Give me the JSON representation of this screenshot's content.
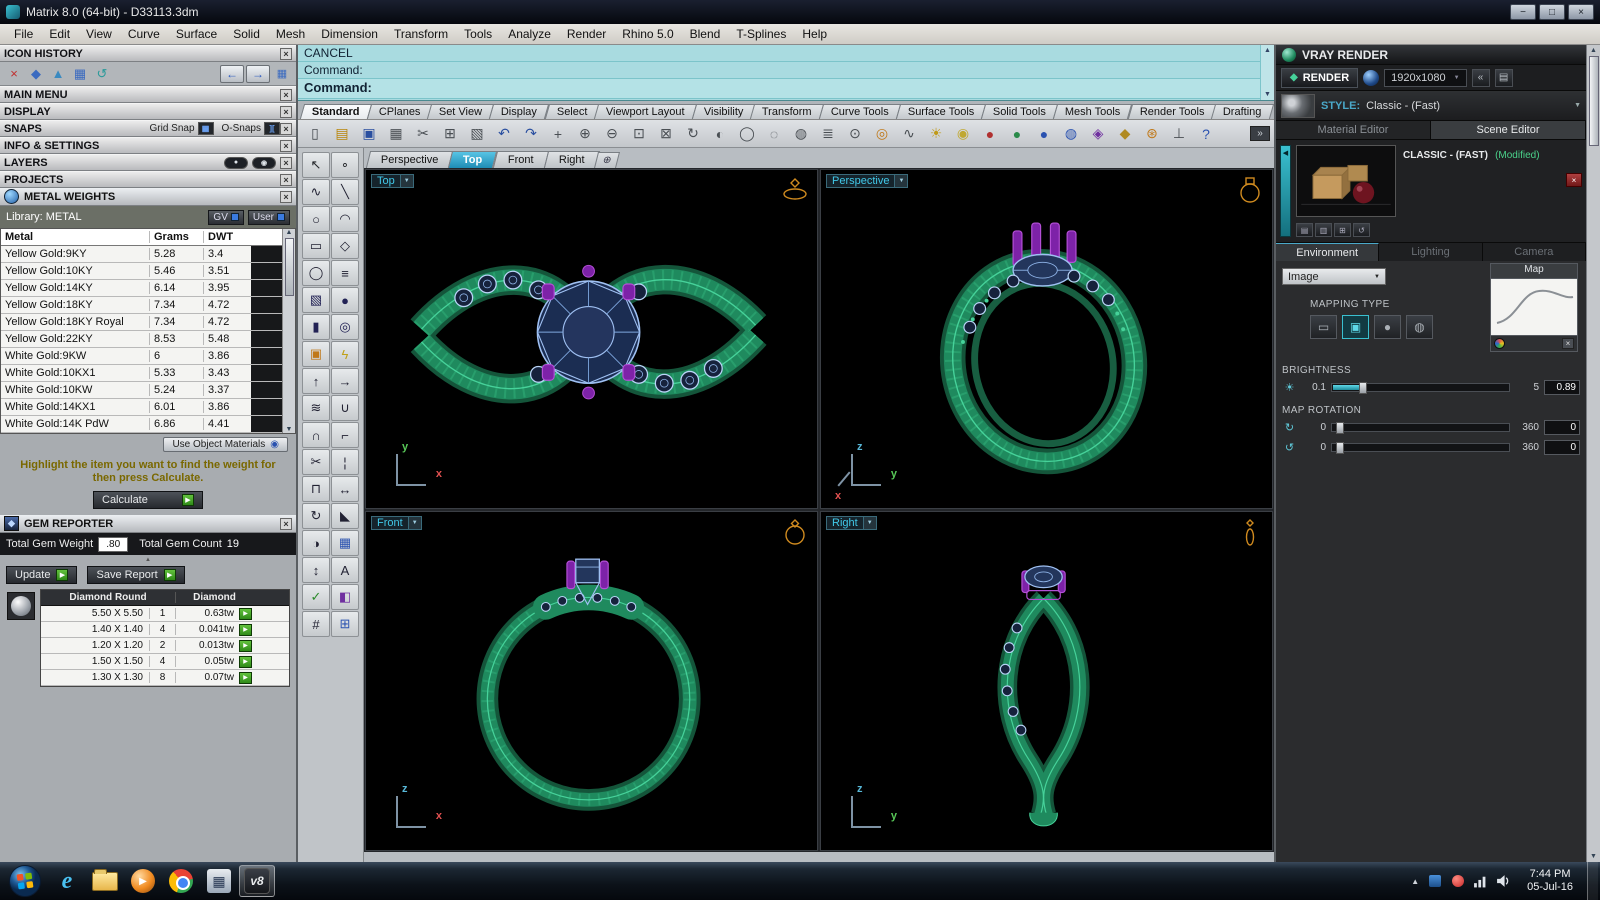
{
  "window": {
    "title": "Matrix 8.0 (64-bit) - D33113.3dm"
  },
  "glyphs": {
    "dropdown": "▼",
    "close": "×",
    "up": "▲",
    "down": "▼",
    "play": "▶",
    "back": "←",
    "forward": "→",
    "overflow": "»",
    "plus": "⊕",
    "grid": "▦",
    "minimize": "−",
    "maximize": "□",
    "collapse": "▲",
    "left_collapse": "◀",
    "sun": "☀",
    "rotate_u": "↻",
    "rotate_v": "↺",
    "ie": "e",
    "wmp_play": "▶",
    "calc_grid": "▦",
    "v8": "v8",
    "double_back": "«",
    "frames": "▤"
  },
  "menu": {
    "items": [
      "File",
      "Edit",
      "View",
      "Curve",
      "Surface",
      "Solid",
      "Mesh",
      "Dimension",
      "Transform",
      "Tools",
      "Analyze",
      "Render",
      "Rhino 5.0",
      "Blend",
      "T-Splines",
      "Help"
    ]
  },
  "command": {
    "line1": "CANCEL",
    "line2": "Command:",
    "prompt": "Command:"
  },
  "toolbar_tabs": [
    "Standard",
    "CPlanes",
    "Set View",
    "Display",
    "Select",
    "Viewport Layout",
    "Visibility",
    "Transform",
    "Curve Tools",
    "Surface Tools",
    "Solid Tools",
    "Mesh Tools",
    "Render Tools",
    "Drafting"
  ],
  "main_toolbar": {
    "icons": [
      {
        "name": "new-file-icon",
        "glyph": "▯",
        "color": "#4a4f54"
      },
      {
        "name": "open-file-icon",
        "glyph": "▤",
        "color": "#b8860b"
      },
      {
        "name": "save-icon",
        "glyph": "▣",
        "color": "#2a4fa0"
      },
      {
        "name": "print-icon",
        "glyph": "▦",
        "color": "#4a4f54"
      },
      {
        "name": "cut-icon",
        "glyph": "✂",
        "color": "#4a4f54"
      },
      {
        "name": "copy-icon",
        "glyph": "⊞",
        "color": "#4a4f54"
      },
      {
        "name": "paste-icon",
        "glyph": "▧",
        "color": "#4a4f54"
      },
      {
        "name": "undo-icon",
        "glyph": "↶",
        "color": "#2a4fa0"
      },
      {
        "name": "redo-icon",
        "glyph": "↷",
        "color": "#2a4fa0"
      },
      {
        "name": "pan-icon",
        "glyph": "+",
        "color": "#4a4f54"
      },
      {
        "name": "zoom-in-icon",
        "glyph": "⊕",
        "color": "#4a4f54"
      },
      {
        "name": "zoom-out-icon",
        "glyph": "⊖",
        "color": "#4a4f54"
      },
      {
        "name": "zoom-window-icon",
        "glyph": "⊡",
        "color": "#4a4f54"
      },
      {
        "name": "zoom-extents-icon",
        "glyph": "⊠",
        "color": "#4a4f54"
      },
      {
        "name": "rotate-view-icon",
        "glyph": "↻",
        "color": "#4a4f54"
      },
      {
        "name": "shaded-view-icon",
        "glyph": "◐",
        "color": "#4a4f54"
      },
      {
        "name": "wireframe-view-icon",
        "glyph": "◯",
        "color": "#4a4f54"
      },
      {
        "name": "hide-objects-icon",
        "glyph": "◌",
        "color": "#4a4f54"
      },
      {
        "name": "lock-objects-icon",
        "glyph": "◍",
        "color": "#4a4f54"
      },
      {
        "name": "layer-manager-icon",
        "glyph": "≣",
        "color": "#4a4f54"
      },
      {
        "name": "object-snap-icon",
        "glyph": "⊙",
        "color": "#4a4f54"
      },
      {
        "name": "gumball-icon",
        "glyph": "◎",
        "color": "#c07818"
      },
      {
        "name": "record-history-icon",
        "glyph": "∿",
        "color": "#4a4f54"
      },
      {
        "name": "sun-light-icon",
        "glyph": "☀",
        "color": "#c09a18"
      },
      {
        "name": "bulb-icon",
        "glyph": "◉",
        "color": "#c0a830"
      },
      {
        "name": "material-red-icon",
        "glyph": "●",
        "color": "#b03030"
      },
      {
        "name": "material-green-icon",
        "glyph": "●",
        "color": "#2a8a4a"
      },
      {
        "name": "material-blue-icon",
        "glyph": "●",
        "color": "#2a52b0"
      },
      {
        "name": "environment-icon",
        "glyph": "◍",
        "color": "#2a52b0"
      },
      {
        "name": "texture-icon",
        "glyph": "◈",
        "color": "#7030a0"
      },
      {
        "name": "gem-drop-icon",
        "glyph": "◆",
        "color": "#b08a20"
      },
      {
        "name": "settings-gear-icon",
        "glyph": "⊛",
        "color": "#c07818"
      },
      {
        "name": "cplane-icon",
        "glyph": "⊥",
        "color": "#4a4f54"
      },
      {
        "name": "help-icon",
        "glyph": "?",
        "color": "#2a52b0"
      }
    ]
  },
  "tool_palette": {
    "icons": [
      {
        "name": "select-pointer-icon",
        "glyph": "↖",
        "color": "#23262a"
      },
      {
        "name": "point-tool-icon",
        "glyph": "∘",
        "color": "#23262a"
      },
      {
        "name": "curve-tool-icon",
        "glyph": "∿",
        "color": "#223"
      },
      {
        "name": "line-tool-icon",
        "glyph": "╲",
        "color": "#223"
      },
      {
        "name": "circle-tool-icon",
        "glyph": "○",
        "color": "#223"
      },
      {
        "name": "arc-tool-icon",
        "glyph": "◠",
        "color": "#223"
      },
      {
        "name": "rectangle-tool-icon",
        "glyph": "▭",
        "color": "#223"
      },
      {
        "name": "polygon-tool-icon",
        "glyph": "◇",
        "color": "#223"
      },
      {
        "name": "ellipse-tool-icon",
        "glyph": "◯",
        "color": "#223"
      },
      {
        "name": "offset-tool-icon",
        "glyph": "≡",
        "color": "#223"
      },
      {
        "name": "box-tool-icon",
        "glyph": "▧",
        "color": "#225"
      },
      {
        "name": "sphere-tool-icon",
        "glyph": "●",
        "color": "#225"
      },
      {
        "name": "cylinder-tool-icon",
        "glyph": "▮",
        "color": "#225"
      },
      {
        "name": "torus-tool-icon",
        "glyph": "◎",
        "color": "#225"
      },
      {
        "name": "puzzle-builder-icon",
        "glyph": "▣",
        "color": "#c07818"
      },
      {
        "name": "lightning-fast-icon",
        "glyph": "ϟ",
        "color": "#c0a018"
      },
      {
        "name": "extrude-tool-icon",
        "glyph": "↑",
        "color": "#223"
      },
      {
        "name": "sweep-tool-icon",
        "glyph": "→",
        "color": "#223"
      },
      {
        "name": "loft-tool-icon",
        "glyph": "≋",
        "color": "#223"
      },
      {
        "name": "boolean-union-icon",
        "glyph": "∪",
        "color": "#223"
      },
      {
        "name": "boolean-diff-icon",
        "glyph": "∩",
        "color": "#223"
      },
      {
        "name": "fillet-tool-icon",
        "glyph": "⌐",
        "color": "#223"
      },
      {
        "name": "trim-tool-icon",
        "glyph": "✂",
        "color": "#223"
      },
      {
        "name": "split-tool-icon",
        "glyph": "¦",
        "color": "#223"
      },
      {
        "name": "join-tool-icon",
        "glyph": "⊓",
        "color": "#223"
      },
      {
        "name": "move-tool-icon",
        "glyph": "↔",
        "color": "#223"
      },
      {
        "name": "rotate-tool-icon",
        "glyph": "↻",
        "color": "#223"
      },
      {
        "name": "scale-tool-icon",
        "glyph": "◣",
        "color": "#223"
      },
      {
        "name": "mirror-tool-icon",
        "glyph": "◑",
        "color": "#223"
      },
      {
        "name": "array-tool-icon",
        "glyph": "▦",
        "color": "#2a52b0"
      },
      {
        "name": "dimension-tool-icon",
        "glyph": "↕",
        "color": "#223"
      },
      {
        "name": "text-tool-icon",
        "glyph": "A",
        "color": "#223"
      },
      {
        "name": "check-tool-icon",
        "glyph": "✓",
        "color": "#2a8a2a"
      },
      {
        "name": "paint-tool-icon",
        "glyph": "◧",
        "color": "#7030a0"
      },
      {
        "name": "measure-tool-icon",
        "glyph": "#",
        "color": "#223"
      },
      {
        "name": "grid-display-icon",
        "glyph": "⊞",
        "color": "#2a52b0"
      }
    ]
  },
  "viewport_tabs": [
    "Perspective",
    "Top",
    "Front",
    "Right"
  ],
  "viewports": [
    {
      "label": "Top",
      "up_axis": "y",
      "right_axis": "x"
    },
    {
      "label": "Perspective",
      "up_axis": "z",
      "right_axis": "y",
      "depth_axis": "x"
    },
    {
      "label": "Front",
      "up_axis": "z",
      "right_axis": "x"
    },
    {
      "label": "Right",
      "up_axis": "z",
      "right_axis": "y"
    }
  ],
  "sidebar": {
    "icon_history_title": "ICON HISTORY",
    "history_icons": [
      {
        "name": "history-delete-icon",
        "glyph": "×",
        "color": "#c03030"
      },
      {
        "name": "history-gem-icon",
        "glyph": "◆",
        "color": "#3a6ac0"
      },
      {
        "name": "history-prong-icon",
        "glyph": "▲",
        "color": "#3a8ac0"
      },
      {
        "name": "history-pave-icon",
        "glyph": "▦",
        "color": "#3a6ac0"
      },
      {
        "name": "history-rail-icon",
        "glyph": "↺",
        "color": "#2a9a9a"
      }
    ],
    "main_menu_title": "MAIN MENU",
    "display_title": "DISPLAY",
    "snaps_title": "SNAPS",
    "grid_snap_label": "Grid Snap",
    "o_snaps_label": "O-Snaps",
    "info_settings_title": "INFO & SETTINGS",
    "layers_title": "LAYERS",
    "projects_title": "PROJECTS"
  },
  "metal_weights": {
    "title": "METAL WEIGHTS",
    "library_label": "Library: METAL",
    "gv_label": "GV",
    "user_label": "User",
    "columns": [
      "Metal",
      "Grams",
      "DWT"
    ],
    "rows": [
      [
        "Yellow Gold:9KY",
        "5.28",
        "3.4"
      ],
      [
        "Yellow Gold:10KY",
        "5.46",
        "3.51"
      ],
      [
        "Yellow Gold:14KY",
        "6.14",
        "3.95"
      ],
      [
        "Yellow Gold:18KY",
        "7.34",
        "4.72"
      ],
      [
        "Yellow Gold:18KY Royal",
        "7.34",
        "4.72"
      ],
      [
        "Yellow Gold:22KY",
        "8.53",
        "5.48"
      ],
      [
        "White Gold:9KW",
        "6",
        "3.86"
      ],
      [
        "White Gold:10KX1",
        "5.33",
        "3.43"
      ],
      [
        "White Gold:10KW",
        "5.24",
        "3.37"
      ],
      [
        "White Gold:14KX1",
        "6.01",
        "3.86"
      ],
      [
        "White Gold:14K PdW",
        "6.86",
        "4.41"
      ]
    ],
    "use_object_materials": "Use Object Materials",
    "hint": "Highlight the item you want to find the weight for then press Calculate.",
    "calculate_label": "Calculate"
  },
  "gem_reporter": {
    "title": "GEM REPORTER",
    "total_weight_label": "Total Gem Weight",
    "total_weight": ".80",
    "total_count_label": "Total Gem Count",
    "total_count": "19",
    "update_label": "Update",
    "save_report_label": "Save Report",
    "columns": [
      "Diamond Round",
      "Diamond"
    ],
    "rows": [
      [
        "5.50 X 5.50",
        "1",
        "0.63tw"
      ],
      [
        "1.40 X 1.40",
        "4",
        "0.041tw"
      ],
      [
        "1.20 X 1.20",
        "2",
        "0.013tw"
      ],
      [
        "1.50 X 1.50",
        "4",
        "0.05tw"
      ],
      [
        "1.30 X 1.30",
        "8",
        "0.07tw"
      ]
    ]
  },
  "vray": {
    "title": "VRAY RENDER",
    "render_label": "RENDER",
    "resolution": "1920x1080",
    "style_label": "STYLE:",
    "style_value": "Classic - (Fast)",
    "editor_tabs": [
      "Material Editor",
      "Scene Editor"
    ],
    "material_name": "CLASSIC - (FAST)",
    "modified": "(Modified)",
    "env_tabs": [
      "Environment",
      "Lighting",
      "Camera"
    ],
    "image_dropdown": "Image",
    "mapping_type_label": "MAPPING TYPE",
    "mapping_icons": [
      {
        "name": "mapping-plane-icon",
        "glyph": "▭"
      },
      {
        "name": "mapping-cube-icon",
        "glyph": "▣"
      },
      {
        "name": "mapping-sphere-icon",
        "glyph": "●"
      },
      {
        "name": "mapping-shrinkwrap-icon",
        "glyph": "◍"
      }
    ],
    "map_label": "Map",
    "brightness_label": "BRIGHTNESS",
    "brightness_min": "0.1",
    "brightness_max": "5",
    "brightness_value": "0.89",
    "map_rotation_label": "MAP ROTATION",
    "rot1_min": "0",
    "rot1_max": "360",
    "rot1_value": "0",
    "rot2_min": "0",
    "rot2_max": "360",
    "rot2_value": "0"
  },
  "taskbar": {
    "apps": [
      "internet-explorer",
      "windows-explorer",
      "media-player",
      "chrome",
      "calculator",
      "matrix-v8"
    ],
    "time": "7:44 PM",
    "date": "05-Jul-16"
  }
}
